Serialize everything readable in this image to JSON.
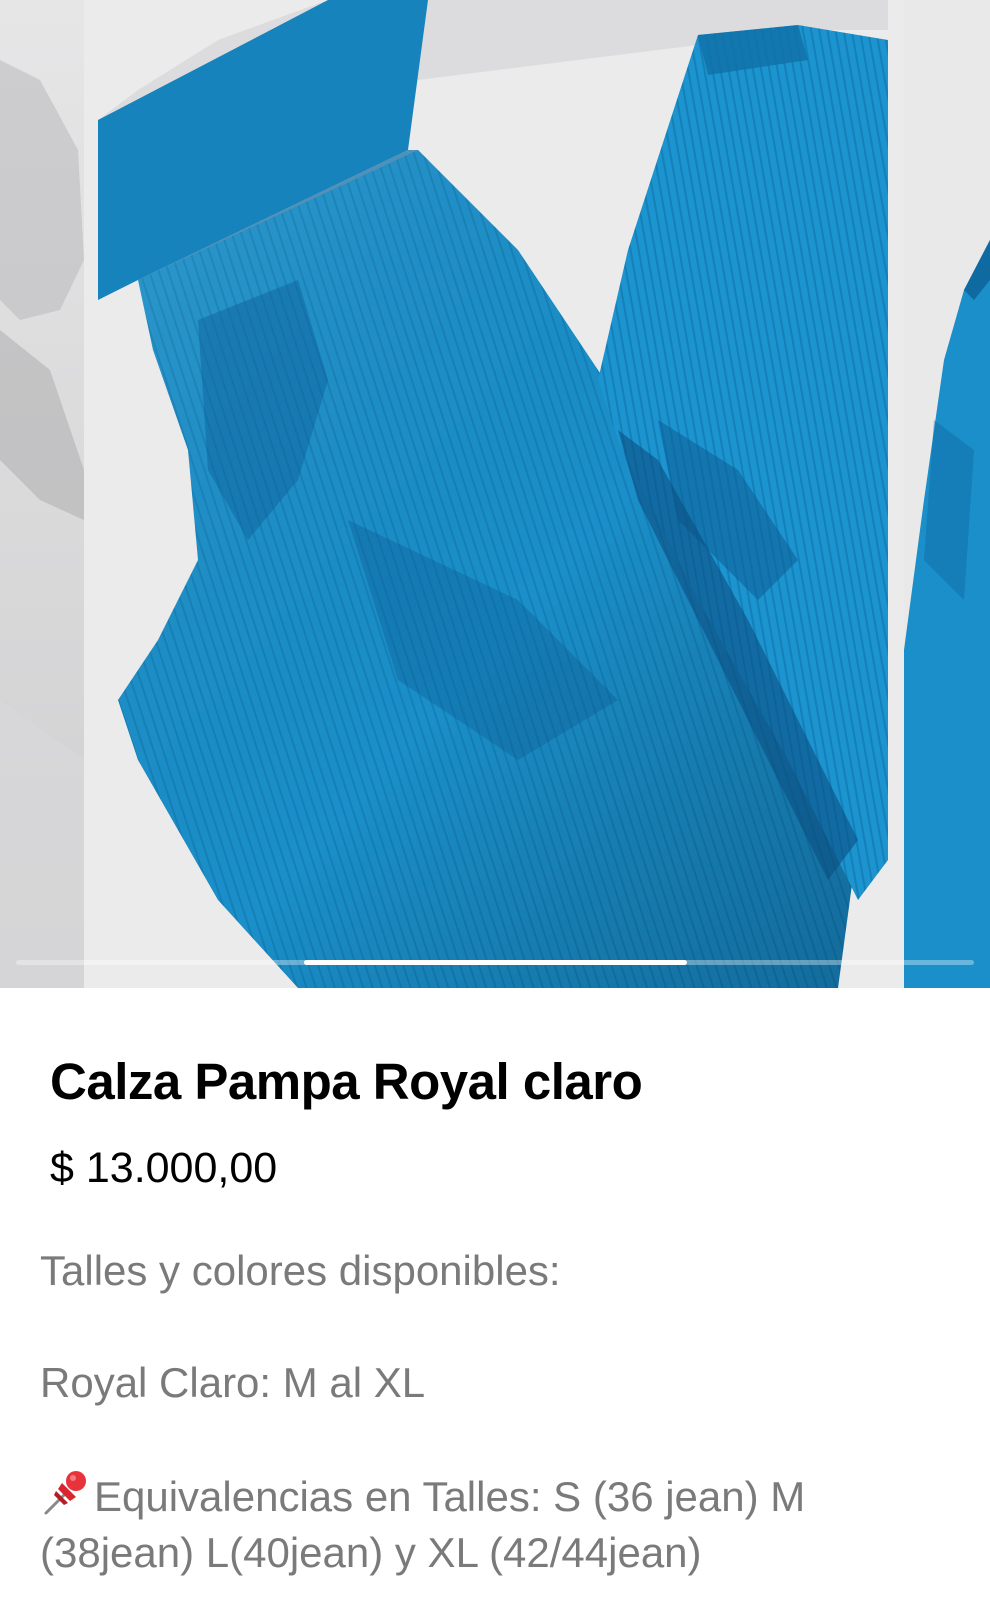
{
  "gallery": {
    "slide_count": 3,
    "active_index": 1,
    "indicator_position": 0.5,
    "product_color": "#1a8fc9",
    "shadow_color": "#0e5f99"
  },
  "product": {
    "title": "Calza Pampa Royal claro",
    "price": "$ 13.000,00"
  },
  "description": {
    "line1": "Talles y colores disponibles:",
    "line2": "Royal Claro: M al XL",
    "pin_icon": "pushpin-icon",
    "line3": "Equivalencias en Talles: S (36 jean) M (38jean) L(40jean) y XL (42/44jean)"
  }
}
